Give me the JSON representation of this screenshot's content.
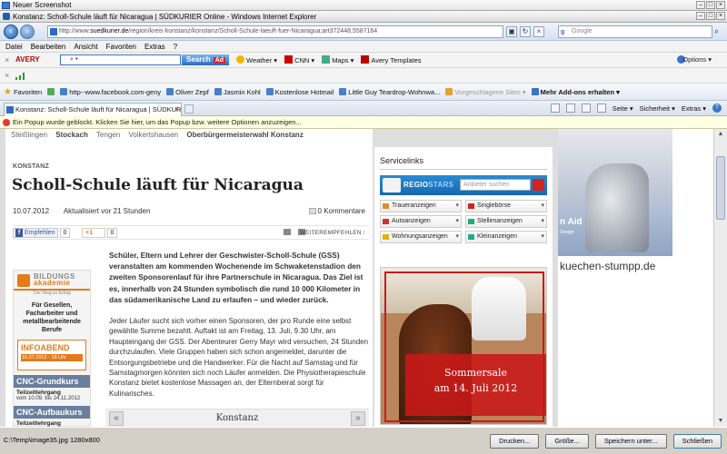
{
  "viewer": {
    "title": "Neuer Screenshot",
    "status_path": "C:\\Temp\\image35.jpg 1280x800",
    "buttons": {
      "print": "Drucken...",
      "size": "Größe...",
      "save": "Speichern unter...",
      "close": "Schließen"
    }
  },
  "browser": {
    "title": "Konstanz: Scholl-Schule läuft für Nicaragua | SÜDKURIER Online - Windows Internet Explorer",
    "address": {
      "prefix": "http://www.",
      "domain": "suedkurier.de",
      "rest": "/region/kreis-konstanz/konstanz/Scholl-Schule-laeuft-fuer-Nicaragua;art372448,5587164"
    },
    "search_placeholder": "Google",
    "menu": [
      "Datei",
      "Bearbeiten",
      "Ansicht",
      "Favoriten",
      "Extras",
      "?"
    ],
    "avery_toolbar": {
      "brand": "AVERY",
      "search_button": "Search",
      "search_badge": "Ad",
      "items": [
        "Weather",
        "CNN",
        "Maps",
        "Avery Templates"
      ],
      "options": "Options"
    },
    "favorites": {
      "label": "Favoriten",
      "items": [
        "http--www.facebook.com-geny",
        "Oliver Zepf",
        "Jasmin Kohl",
        "Kostenlose Hotmail",
        "Little Guy Teardrop-Wohnwa...",
        "Vorgeschlagene Sites",
        "Mehr Add-ons erhalten"
      ]
    },
    "tab_title": "Konstanz: Scholl-Schule läuft für Nicaragua | SÜDKURIE...",
    "command_bar": [
      "Seite",
      "Sicherheit",
      "Extras"
    ],
    "info_bar": "Ein Popup wurde geblockt. Klicken Sie hier, um das Popup bzw. weitere Optionen anzuzeigen..."
  },
  "page": {
    "subnav": [
      "Steißlingen",
      "Stockach",
      "Tengen",
      "Volkertshausen",
      "Oberbürgermeisterwahl Konstanz"
    ],
    "kicker": "KONSTANZ",
    "headline": "Scholl-Schule läuft für Nicaragua",
    "date": "10.07.2012",
    "updated": "Aktualisiert vor 21 Stunden",
    "comments": "0 Kommentare",
    "share": {
      "facebook": "Empfehlen",
      "fb_count": "0",
      "gplus": "+1",
      "gplus_count": "0",
      "recommend": "WEITEREMPFEHLEN"
    },
    "lead": "Schüler, Eltern und Lehrer der Geschwister-Scholl-Schule (GSS) veranstalten am kommenden Wochenende im Schwaketenstadion den zweiten Sponsorenlauf für ihre Partnerschule in Nicaragua. Das Ziel ist es, innerhalb von 24 Stunden symbolisch die rund 10 000 Kilometer in das südamerikanische Land zu erlaufen – und wieder zurück.",
    "body": "Jeder Läufer sucht sich vorher einen Sponsoren, der pro Runde eine selbst gewählte Summe bezahlt. Auftakt ist am Freitag, 13. Juli, 9.30 Uhr, am Haupteingang der GSS. Der Abenteurer Gerry Mayr wird versuchen, 24 Stunden durchzulaufen. Viele Gruppen haben sich schon angemeldet, darunter die Entsorgungsbetriebe und die Handwerker. Für die Nacht auf Samstag und für Samstagmorgen könnten sich noch Läufer anmelden. Die Physiotherapieschule Konstanz bietet kostenlose Massagen an, der Elternbeirat sorgt für Kulinarisches.",
    "carousel_label": "Konstanz",
    "ad_left": {
      "brand1": "BILDUNGS",
      "brand2": "akademie",
      "tagline": "Der Weg zu Erfolg",
      "fuer": "Für Gesellen, Facharbeiter und metallbearbeitende Berufe",
      "infoabend": "INFOABEND",
      "infoabend_date": "16.07.2012 - 18 Uhr",
      "cnc1": "CNC-Grundkurs",
      "tz_label": "Teilzeitlehrgang",
      "tz_dates": "vom 10.09. bis 24.11.2012",
      "cnc2": "CNC-Aufbaukurs",
      "tz2": "Teilzeitlehrgang"
    },
    "servicelinks": {
      "title": "Servicelinks",
      "regiostars_a": "REGIO",
      "regiostars_b": "STARS",
      "search_placeholder": "Anbieter suchen",
      "items": [
        "Traueranzeigen",
        "Singlebörse",
        "Autoanzeigen",
        "Stellenanzeigen",
        "Wohnungsanzeigen",
        "Kleinanzeigen"
      ]
    },
    "horse_ad": {
      "line1": "Sommersale",
      "line2": "am 14. Juli 2012"
    },
    "kitchen_ad": {
      "brand": "n Aid",
      "small": "Design",
      "url": "kuechen-stumpp.de"
    }
  }
}
